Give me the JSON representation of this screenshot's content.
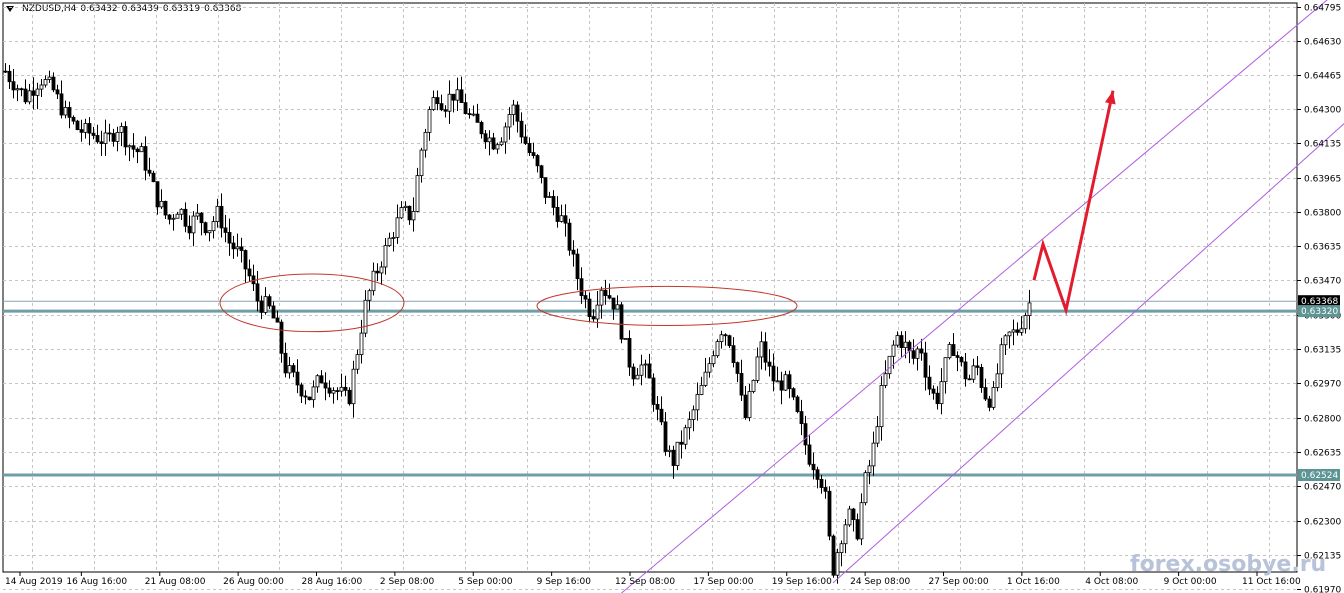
{
  "header": {
    "symbol": "NZDUSD,H4",
    "open": "0.63432",
    "high": "0.63439",
    "low": "0.63319",
    "close": "0.63368"
  },
  "watermark": "forex.osobye.ru",
  "colors": {
    "background": "#ffffff",
    "grid": "#c4c4c4",
    "candle": "#000000",
    "level": "#6e9ea6",
    "level_tag": "#5d9494",
    "current_line": "#8aa1b8",
    "current_tag": "#000000",
    "channel": "#b05ee0",
    "ellipse": "#c0392b",
    "arrow": "#e21b2d"
  },
  "chart_data": {
    "type": "candlestick",
    "symbol": "NZDUSD",
    "timeframe": "H4",
    "ylim": [
      0.62053,
      0.64816
    ],
    "y_ticks": [
      "0.64795",
      "0.64630",
      "0.64465",
      "0.64300",
      "0.64135",
      "0.63965",
      "0.63800",
      "0.63635",
      "0.63470",
      "0.63300",
      "0.63135",
      "0.62970",
      "0.62800",
      "0.62635",
      "0.62470",
      "0.62300",
      "0.62135",
      "0.61970"
    ],
    "x_ticks": [
      "14 Aug 2019",
      "16 Aug 16:00",
      "21 Aug 08:00",
      "26 Aug 00:00",
      "28 Aug 16:00",
      "2 Sep 08:00",
      "5 Sep 00:00",
      "9 Sep 16:00",
      "12 Sep 08:00",
      "17 Sep 00:00",
      "19 Sep 16:00",
      "24 Sep 08:00",
      "27 Sep 00:00",
      "1 Oct 16:00",
      "4 Oct 08:00",
      "9 Oct 00:00",
      "11 Oct 16:00"
    ],
    "grid": true,
    "levels": [
      "0.63320",
      "0.62524"
    ],
    "current_price": "0.63368",
    "close_path": [
      [
        0,
        0.6452
      ],
      [
        10,
        0.6445
      ],
      [
        25,
        0.6436
      ],
      [
        40,
        0.6445
      ],
      [
        52,
        0.644
      ],
      [
        64,
        0.6428
      ],
      [
        78,
        0.642
      ],
      [
        92,
        0.6418
      ],
      [
        106,
        0.6414
      ],
      [
        118,
        0.6422
      ],
      [
        130,
        0.6412
      ],
      [
        142,
        0.6408
      ],
      [
        150,
        0.6396
      ],
      [
        158,
        0.6385
      ],
      [
        168,
        0.6376
      ],
      [
        178,
        0.6383
      ],
      [
        188,
        0.6374
      ],
      [
        198,
        0.6378
      ],
      [
        208,
        0.6372
      ],
      [
        218,
        0.638
      ],
      [
        228,
        0.6366
      ],
      [
        238,
        0.636
      ],
      [
        248,
        0.635
      ],
      [
        258,
        0.6336
      ],
      [
        268,
        0.6334
      ],
      [
        276,
        0.6325
      ],
      [
        284,
        0.6305
      ],
      [
        292,
        0.63
      ],
      [
        300,
        0.6295
      ],
      [
        310,
        0.629
      ],
      [
        320,
        0.63
      ],
      [
        330,
        0.6296
      ],
      [
        340,
        0.6292
      ],
      [
        348,
        0.6288
      ],
      [
        356,
        0.631
      ],
      [
        364,
        0.6333
      ],
      [
        372,
        0.6346
      ],
      [
        382,
        0.6358
      ],
      [
        392,
        0.637
      ],
      [
        402,
        0.638
      ],
      [
        412,
        0.6378
      ],
      [
        420,
        0.6408
      ],
      [
        428,
        0.6428
      ],
      [
        436,
        0.6438
      ],
      [
        444,
        0.6432
      ],
      [
        452,
        0.6438
      ],
      [
        462,
        0.6432
      ],
      [
        472,
        0.6424
      ],
      [
        482,
        0.642
      ],
      [
        492,
        0.6414
      ],
      [
        502,
        0.6418
      ],
      [
        512,
        0.6432
      ],
      [
        520,
        0.642
      ],
      [
        528,
        0.641
      ],
      [
        536,
        0.6402
      ],
      [
        544,
        0.639
      ],
      [
        552,
        0.6383
      ],
      [
        560,
        0.6378
      ],
      [
        568,
        0.6366
      ],
      [
        576,
        0.635
      ],
      [
        584,
        0.6338
      ],
      [
        592,
        0.633
      ],
      [
        600,
        0.6345
      ],
      [
        608,
        0.634
      ],
      [
        616,
        0.6334
      ],
      [
        624,
        0.6316
      ],
      [
        632,
        0.6302
      ],
      [
        640,
        0.6306
      ],
      [
        648,
        0.63
      ],
      [
        656,
        0.6284
      ],
      [
        664,
        0.6268
      ],
      [
        672,
        0.6258
      ],
      [
        680,
        0.6268
      ],
      [
        688,
        0.6276
      ],
      [
        696,
        0.6288
      ],
      [
        704,
        0.6298
      ],
      [
        712,
        0.6312
      ],
      [
        720,
        0.6324
      ],
      [
        728,
        0.632
      ],
      [
        736,
        0.6305
      ],
      [
        744,
        0.6278
      ],
      [
        752,
        0.6296
      ],
      [
        760,
        0.6316
      ],
      [
        768,
        0.6304
      ],
      [
        776,
        0.6296
      ],
      [
        784,
        0.6298
      ],
      [
        792,
        0.6288
      ],
      [
        800,
        0.6276
      ],
      [
        808,
        0.6262
      ],
      [
        816,
        0.6256
      ],
      [
        824,
        0.6246
      ],
      [
        832,
        0.6205
      ],
      [
        840,
        0.6222
      ],
      [
        848,
        0.6234
      ],
      [
        856,
        0.6222
      ],
      [
        864,
        0.6248
      ],
      [
        872,
        0.6262
      ],
      [
        880,
        0.629
      ],
      [
        888,
        0.6306
      ],
      [
        896,
        0.632
      ],
      [
        904,
        0.6316
      ],
      [
        912,
        0.6308
      ],
      [
        920,
        0.6316
      ],
      [
        928,
        0.6296
      ],
      [
        936,
        0.6288
      ],
      [
        944,
        0.6304
      ],
      [
        952,
        0.6316
      ],
      [
        960,
        0.6306
      ],
      [
        968,
        0.6298
      ],
      [
        976,
        0.6306
      ],
      [
        984,
        0.6292
      ],
      [
        992,
        0.6288
      ],
      [
        1000,
        0.631
      ],
      [
        1008,
        0.632
      ],
      [
        1016,
        0.6322
      ],
      [
        1024,
        0.633
      ],
      [
        1030,
        0.6337
      ]
    ],
    "annotations": {
      "ellipses": [
        {
          "cx": 312,
          "cy": 0.6336,
          "rx": 92,
          "ry_price": 0.0014
        },
        {
          "cx": 667,
          "cy": 0.63345,
          "rx": 130,
          "ry_price": 0.00095
        }
      ],
      "channel_lines": [
        {
          "x1": 614,
          "y1": 0.6192,
          "x2": 1344,
          "y2": 0.649
        },
        {
          "x1": 833,
          "y1": 0.62,
          "x2": 1344,
          "y2": 0.6423
        }
      ],
      "forecast_path": [
        [
          1034,
          0.6347
        ],
        [
          1043,
          0.63645
        ],
        [
          1066,
          0.63325
        ],
        [
          1113,
          0.6439
        ]
      ]
    }
  }
}
